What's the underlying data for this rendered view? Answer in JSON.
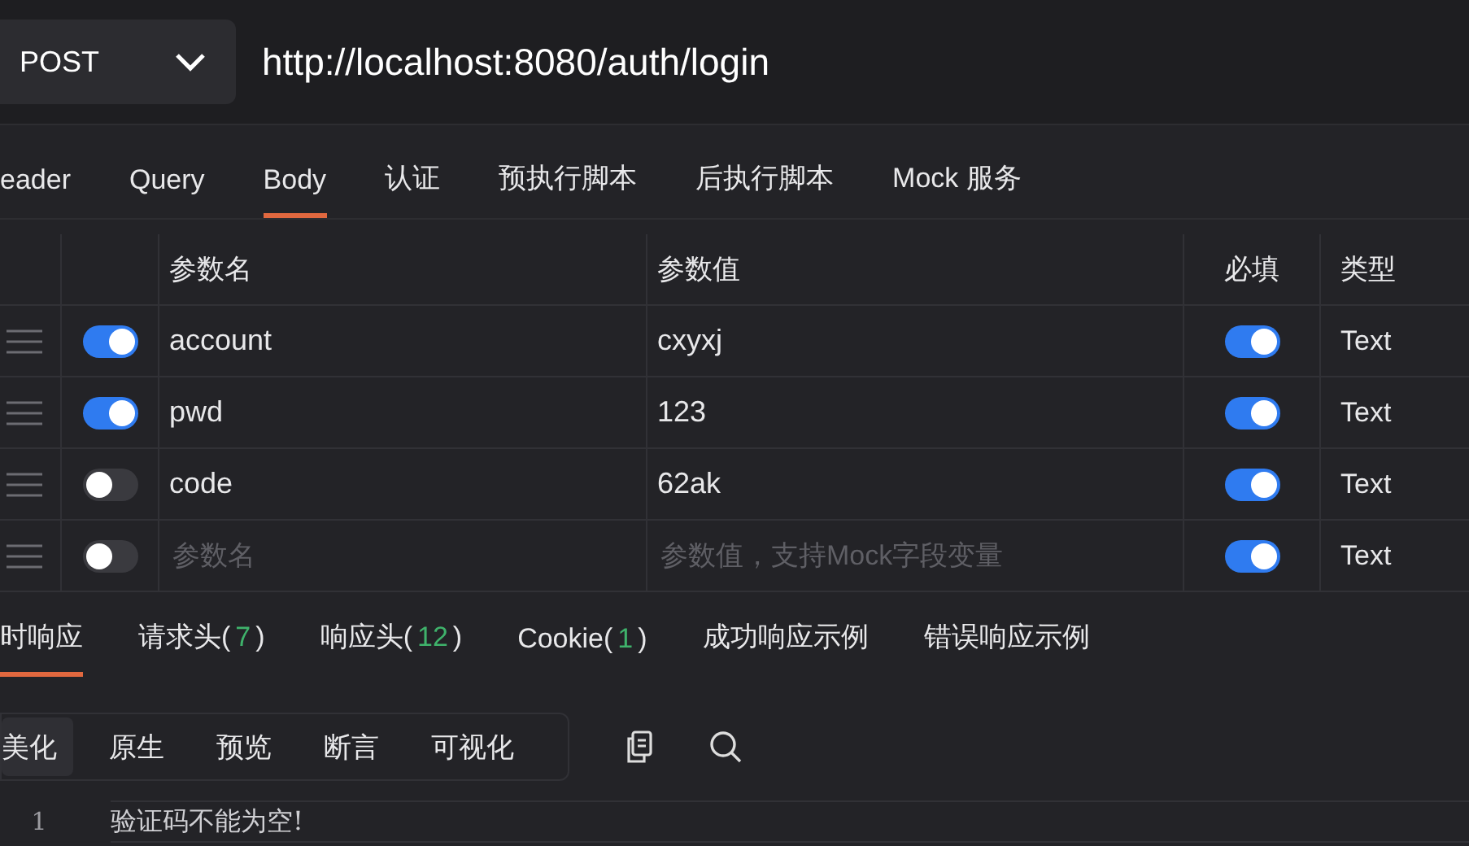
{
  "request": {
    "method": "POST",
    "url": "http://localhost:8080/auth/login"
  },
  "tabs": [
    {
      "label": "eader",
      "selected": false
    },
    {
      "label": "Query",
      "selected": false
    },
    {
      "label": "Body",
      "selected": true
    },
    {
      "label": "认证",
      "selected": false
    },
    {
      "label": "预执行脚本",
      "selected": false
    },
    {
      "label": "后执行脚本",
      "selected": false
    },
    {
      "label": "Mock 服务",
      "selected": false
    }
  ],
  "table": {
    "columns": [
      "参数名",
      "参数值",
      "必填",
      "类型"
    ],
    "rows": [
      {
        "enabled": true,
        "name": "account",
        "value": "cxyxj",
        "required": true,
        "type": "Text"
      },
      {
        "enabled": true,
        "name": "pwd",
        "value": "123",
        "required": true,
        "type": "Text"
      },
      {
        "enabled": false,
        "name": "code",
        "value": "62ak",
        "required": true,
        "type": "Text"
      },
      {
        "enabled": false,
        "name_placeholder": "参数名",
        "value_placeholder": "参数值，支持Mock字段变量",
        "required": true,
        "type": "Text"
      }
    ]
  },
  "response_tabs": [
    {
      "label": "时响应",
      "selected": true
    },
    {
      "label": "请求头(",
      "count": "7",
      "close": ")",
      "selected": false
    },
    {
      "label": "响应头(",
      "count": "12",
      "close": ")",
      "selected": false
    },
    {
      "label": "Cookie(",
      "count": "1",
      "close": ")",
      "selected": false
    },
    {
      "label": "成功响应示例",
      "selected": false
    },
    {
      "label": "错误响应示例",
      "selected": false
    }
  ],
  "view_modes": [
    {
      "label": "美化",
      "selected": true
    },
    {
      "label": "原生",
      "selected": false
    },
    {
      "label": "预览",
      "selected": false
    },
    {
      "label": "断言",
      "selected": false
    },
    {
      "label": "可视化",
      "selected": false
    }
  ],
  "editor": {
    "lines": [
      {
        "number": "1",
        "text": "验证码不能为空!"
      }
    ]
  }
}
